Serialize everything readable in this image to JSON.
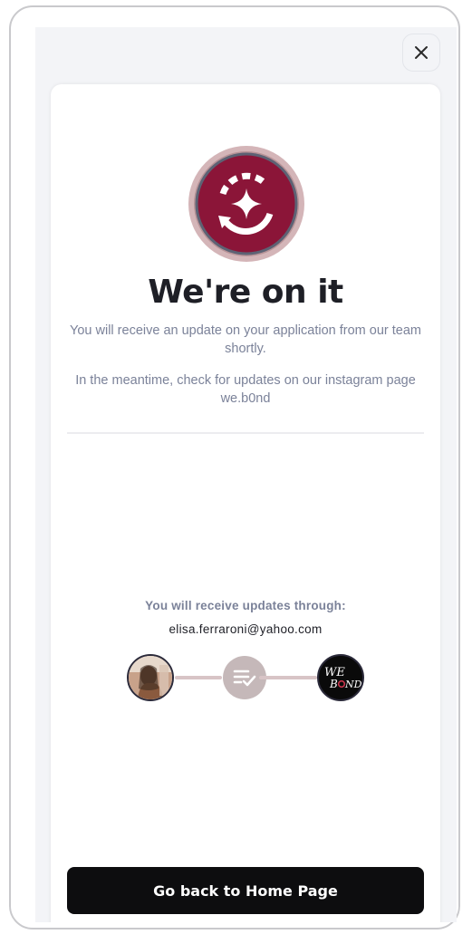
{
  "header": {
    "close_icon": "close-icon"
  },
  "status": {
    "icon": "sync-sparkle-icon",
    "title": "We're on it",
    "message_1": "You will receive an update on your application from our team shortly.",
    "message_2": "In the meantime, check for updates on our instagram page we.b0nd"
  },
  "updates": {
    "label": "You will receive updates through:",
    "email": "elisa.ferraroni@yahoo.com",
    "flow": {
      "user_avatar": "user-avatar",
      "middle_icon": "checklist-icon",
      "brand_logo": "webond-logo",
      "brand_logo_text": "WE BOND"
    }
  },
  "actions": {
    "home_button": "Go back to Home Page"
  },
  "colors": {
    "accent": "#8b1538",
    "ring": "#d4b5b8",
    "connector": "#d8c4c6",
    "button_bg": "#0d0d0f",
    "muted_text": "#7b8299"
  }
}
